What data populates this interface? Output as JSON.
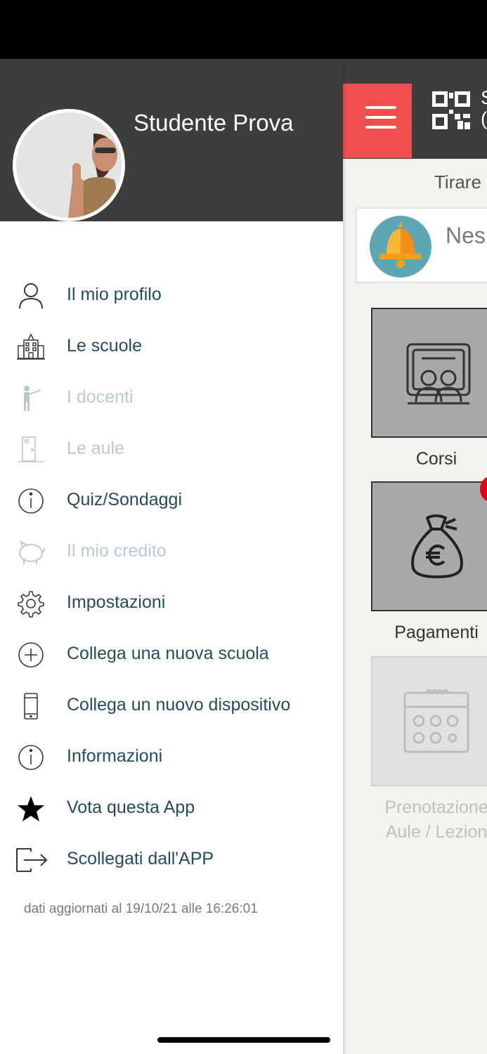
{
  "user": {
    "name": "Studente Prova"
  },
  "menu": [
    {
      "label": "Il mio profilo",
      "icon": "person-icon",
      "enabled": true
    },
    {
      "label": "Le scuole",
      "icon": "school-building-icon",
      "enabled": true
    },
    {
      "label": "I docenti",
      "icon": "teacher-icon",
      "enabled": false
    },
    {
      "label": "Le aule",
      "icon": "classroom-door-icon",
      "enabled": false
    },
    {
      "label": "Quiz/Sondaggi",
      "icon": "info-circle-icon",
      "enabled": true
    },
    {
      "label": "Il mio credito",
      "icon": "piggy-bank-icon",
      "enabled": false
    },
    {
      "label": "Impostazioni",
      "icon": "gear-icon",
      "enabled": true
    },
    {
      "label": "Collega una nuova scuola",
      "icon": "plus-circle-icon",
      "enabled": true
    },
    {
      "label": "Collega un nuovo dispositivo",
      "icon": "smartphone-icon",
      "enabled": true
    },
    {
      "label": "Informazioni",
      "icon": "info-circle-icon",
      "enabled": true
    },
    {
      "label": "Vota questa App",
      "icon": "star-icon",
      "enabled": true
    },
    {
      "label": "Scollegati dall'APP",
      "icon": "logout-icon",
      "enabled": true
    }
  ],
  "footer": {
    "updated": "dati aggiornati al 19/10/21 alle 16:26:01"
  },
  "app": {
    "header_text_1": "S",
    "header_text_2": "(",
    "pull_hint": "Tirare",
    "notification": "Nes",
    "tiles": [
      {
        "label": "Corsi",
        "icon": "course-board-icon",
        "enabled": true
      },
      {
        "label": "Pagamenti",
        "icon": "money-bag-euro-icon",
        "enabled": true
      },
      {
        "label_line1": "Prenotazione",
        "label_line2": "Aule / Lezion",
        "icon": "calendar-icon",
        "enabled": false
      }
    ]
  },
  "colors": {
    "header_bg": "#3d3d3d",
    "menu_text": "#244e5a",
    "menu_text_disabled": "#b7cbd0",
    "hamburger_bg": "#f04e4f",
    "badge": "#e8001a"
  }
}
